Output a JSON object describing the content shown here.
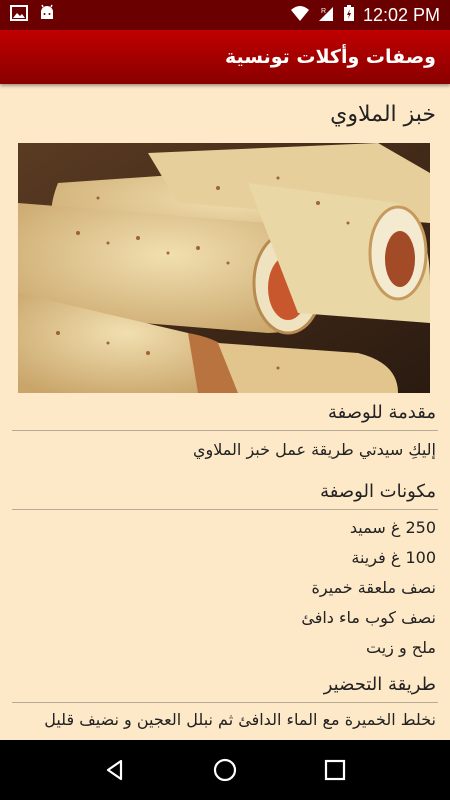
{
  "status_bar": {
    "time": "12:02 PM",
    "icons": [
      "image-icon",
      "android-icon",
      "wifi-icon",
      "signal-icon",
      "battery-icon"
    ]
  },
  "app_bar": {
    "title": "وصفات وأكلات تونسية"
  },
  "recipe": {
    "title": "خبز الملاوي",
    "image_label": "recipe-photo"
  },
  "intro": {
    "heading": "مقدمة للوصفة",
    "text": "إليكِ سيدتي طريقة عمل خبز الملاوي"
  },
  "ingredients": {
    "heading": "مكونات الوصفة",
    "items": [
      "250 غ سميد",
      "100 غ فرينة",
      "نصف ملعقة خميرة",
      "نصف كوب ماء دافئ",
      "ملح و زيت"
    ]
  },
  "preparation": {
    "heading": "طريقة التحضير",
    "text": "نخلط الخميرة مع الماء الدافئ ثم نبلل العجين و نضيف قليل"
  },
  "nav_bar": {
    "buttons": [
      "back",
      "home",
      "recents"
    ]
  },
  "colors": {
    "app_bar": "#b00000",
    "status_bar": "#6b0000",
    "background": "#fde9c8",
    "divider": "#b8ab96"
  }
}
